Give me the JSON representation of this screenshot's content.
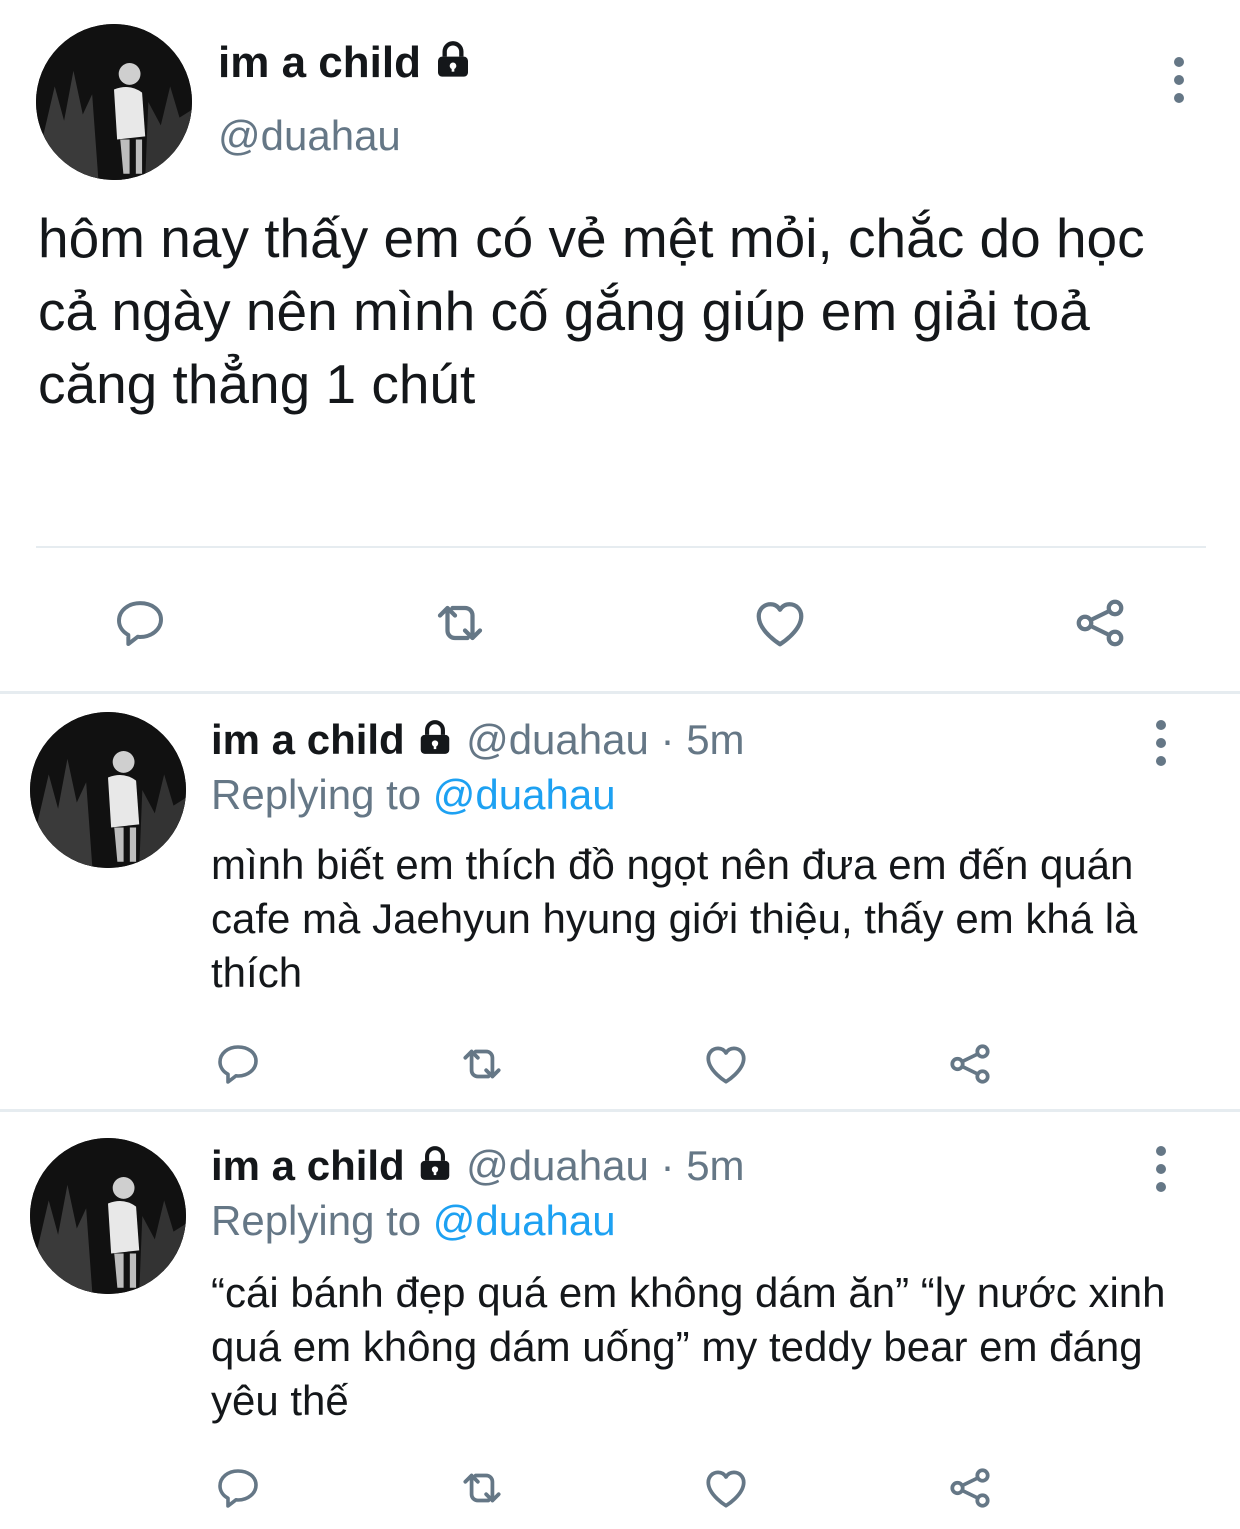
{
  "main_tweet": {
    "display_name": "im a child",
    "handle": "@duahau",
    "text": "hôm nay thấy em có vẻ mệt mỏi, chắc do học cả ngày nên mình cố gắng giúp em giải toả căng thẳng 1 chút"
  },
  "replies": [
    {
      "display_name": "im a child",
      "handle": "@duahau",
      "separator": "·",
      "time": "5m",
      "replying_label": "Replying to",
      "replying_handle": "@duahau",
      "text": "mình biết em thích đồ ngọt nên đưa em đến quán cafe mà Jaehyun hyung giới thiệu, thấy em khá là thích"
    },
    {
      "display_name": "im a child",
      "handle": "@duahau",
      "separator": "·",
      "time": "5m",
      "replying_label": "Replying to",
      "replying_handle": "@duahau",
      "text": "“cái bánh đẹp quá em không dám ăn” “ly nước xinh quá em không dám uống” my teddy bear em đáng yêu thế"
    }
  ],
  "icons": {
    "lock": "lock-icon",
    "more": "more-vertical-icon",
    "reply": "reply-icon",
    "retweet": "retweet-icon",
    "like": "heart-icon",
    "share": "share-icon"
  },
  "colors": {
    "link": "#1da1f2",
    "secondary": "#657786",
    "divider": "#e6ecf0"
  }
}
